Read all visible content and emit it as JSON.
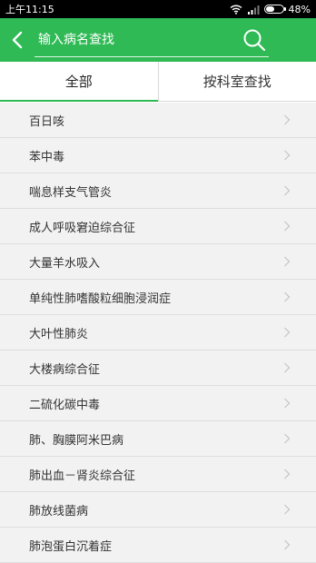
{
  "status": {
    "time": "上午11:15",
    "battery": "48%",
    "battery_level": 0.48
  },
  "search": {
    "placeholder": "输入病名查找"
  },
  "tabs": [
    {
      "label": "全部",
      "active": true
    },
    {
      "label": "按科室查找",
      "active": false
    }
  ],
  "diseases": [
    "百日咳",
    "苯中毒",
    "喘息样支气管炎",
    "成人呼吸窘迫综合征",
    "大量羊水吸入",
    "单纯性肺嗜酸粒细胞浸润症",
    "大叶性肺炎",
    "大楼病综合征",
    "二硫化碳中毒",
    "肺、胸膜阿米巴病",
    "肺出血－肾炎综合征",
    "肺放线菌病",
    "肺泡蛋白沉着症"
  ],
  "colors": {
    "brand": "#2fba55",
    "list_bg": "#f2f2f2"
  },
  "icons": {
    "back": "chevron-left-icon",
    "search": "search-icon",
    "row": "chevron-right-icon"
  }
}
